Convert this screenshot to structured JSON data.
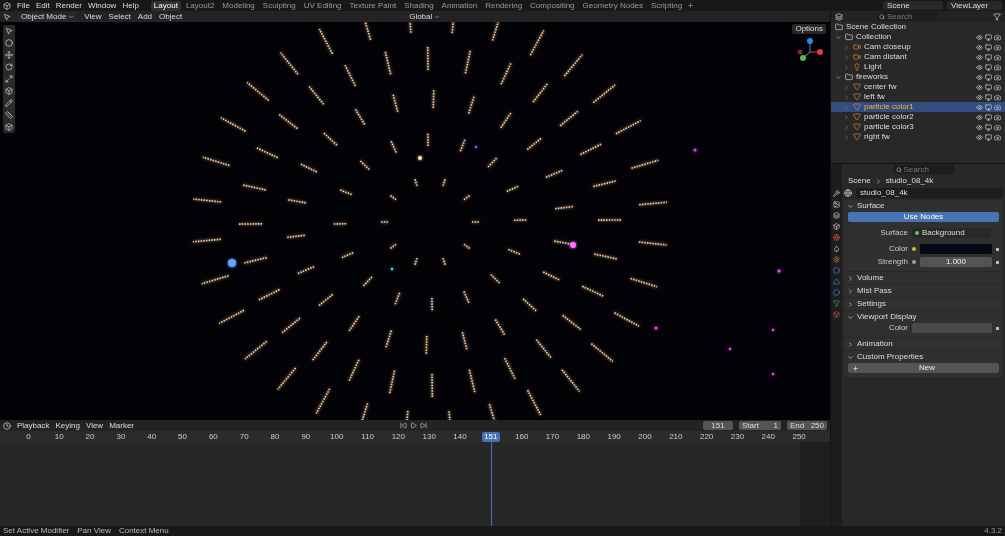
{
  "top_menu": [
    "File",
    "Edit",
    "Render",
    "Window",
    "Help"
  ],
  "workspaces": [
    {
      "label": "Layout",
      "selected": true
    },
    {
      "label": "Layout2",
      "selected": false
    },
    {
      "label": "Modeling",
      "selected": false
    },
    {
      "label": "Sculpting",
      "selected": false
    },
    {
      "label": "UV Editing",
      "selected": false
    },
    {
      "label": "Texture Paint",
      "selected": false
    },
    {
      "label": "Shading",
      "selected": false
    },
    {
      "label": "Animation",
      "selected": false
    },
    {
      "label": "Rendering",
      "selected": false
    },
    {
      "label": "Compositing",
      "selected": false
    },
    {
      "label": "Geometry Nodes",
      "selected": false
    },
    {
      "label": "Scripting",
      "selected": false
    }
  ],
  "scene": "Scene",
  "view_layer": "ViewLayer",
  "viewport": {
    "mode": "Object Mode",
    "menus": [
      "View",
      "Select",
      "Add",
      "Object"
    ],
    "orientation": "Global",
    "options": "Options"
  },
  "outliner": {
    "search_placeholder": "Search",
    "root": "Scene Collection",
    "items": [
      {
        "name": "Collection",
        "kind": "collection",
        "expanded": true,
        "children": [
          {
            "name": "Cam closeup",
            "kind": "camera",
            "selected": false
          },
          {
            "name": "Cam distant",
            "kind": "camera",
            "selected": false
          },
          {
            "name": "Light",
            "kind": "light",
            "selected": false
          }
        ]
      },
      {
        "name": "fireworks",
        "kind": "collection",
        "expanded": true,
        "children": [
          {
            "name": "center fw",
            "kind": "mesh",
            "selected": false
          },
          {
            "name": "left fw",
            "kind": "mesh",
            "selected": false
          },
          {
            "name": "particle color1",
            "kind": "mesh",
            "selected": true
          },
          {
            "name": "particle color2",
            "kind": "mesh",
            "selected": false
          },
          {
            "name": "particle color3",
            "kind": "mesh",
            "selected": false
          },
          {
            "name": "right fw",
            "kind": "mesh",
            "selected": false
          }
        ]
      }
    ]
  },
  "properties": {
    "search_placeholder": "Search",
    "breadcrumb": [
      "Scene",
      "studio_08_4k"
    ],
    "world": "studio_08_4k",
    "panels": [
      {
        "title": "Surface",
        "expanded": true,
        "kind": "surface"
      },
      {
        "title": "Volume",
        "expanded": false
      },
      {
        "title": "Mist Pass",
        "expanded": false
      },
      {
        "title": "Settings",
        "expanded": false
      },
      {
        "title": "Viewport Display",
        "expanded": true,
        "kind": "display"
      },
      {
        "title": "Animation",
        "expanded": false
      },
      {
        "title": "Custom Properties",
        "expanded": true,
        "kind": "custom"
      }
    ],
    "use_nodes": "Use Nodes",
    "surface_label": "Surface",
    "surface_value": "Background",
    "color_label": "Color",
    "strength_label": "Strength",
    "strength_value": "1.000",
    "display_color_label": "Color",
    "new_button": "New"
  },
  "timeline": {
    "menus": [
      "Playback",
      "Keying",
      "View",
      "Marker"
    ],
    "current_frame": "151",
    "start_label": "Start",
    "start": "1",
    "end_label": "End",
    "end": "250",
    "ticks_before": [
      "0",
      "10",
      "20",
      "30",
      "40",
      "50",
      "60",
      "70",
      "80",
      "90",
      "100",
      "110",
      "120",
      "130",
      "140"
    ],
    "playhead": "151",
    "ticks_after": [
      "160",
      "170",
      "180",
      "190",
      "200",
      "210",
      "220",
      "230",
      "240",
      "250"
    ]
  },
  "status_bar": {
    "hints": [
      "Set Active Modifier",
      "Pan View",
      "Context Menu"
    ],
    "version": "4.3.2"
  }
}
